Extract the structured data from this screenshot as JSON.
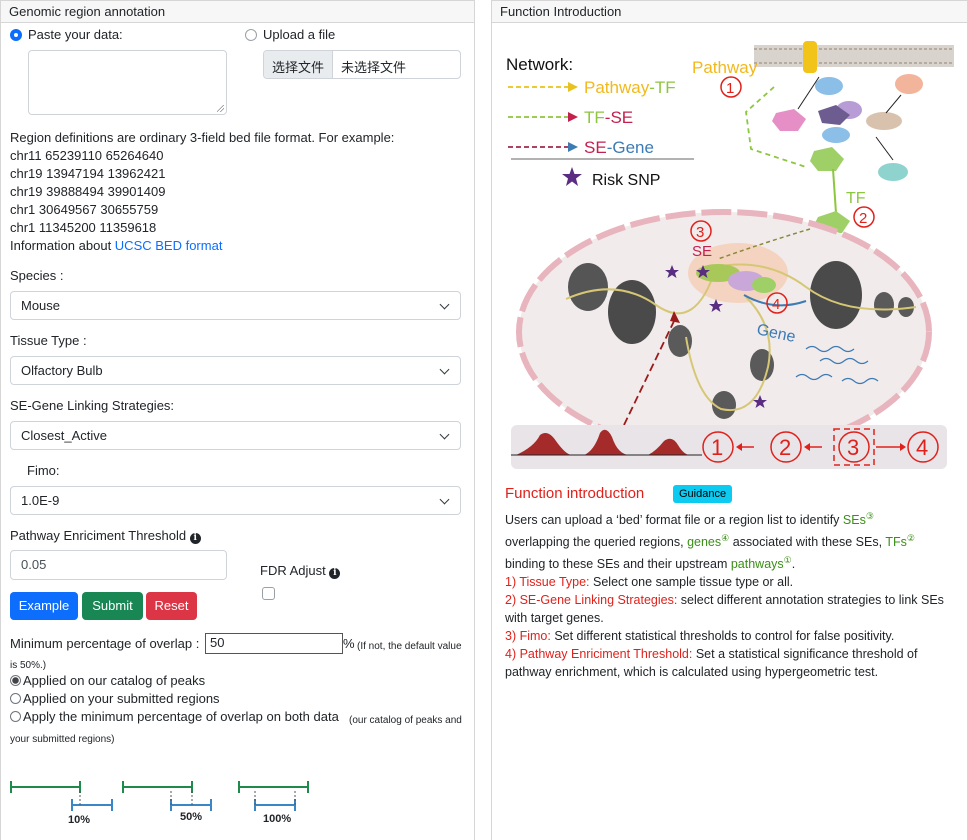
{
  "left": {
    "header": "Genomic region annotation",
    "paste_label": "Paste your data:",
    "upload_label": "Upload a file",
    "file_button": "选择文件",
    "file_status": "未选择文件",
    "bed_intro": "Region definitions are ordinary 3-field bed file format. For example:",
    "bed_examples": [
      "chr11 65239110 65264640",
      "chr19 13947194 13962421",
      "chr19 39888494 39901409",
      "chr1 30649567 30655759",
      "chr1 11345200 11359618"
    ],
    "info_prefix": "Information about ",
    "info_link": "UCSC BED format",
    "species_label": "Species :",
    "species_value": "Mouse",
    "tissue_label": "Tissue Type :",
    "tissue_value": "Olfactory Bulb",
    "linking_label": "SE-Gene Linking Strategies:",
    "linking_value": "Closest_Active",
    "fimo_label": "Fimo:",
    "fimo_value": "1.0E-9",
    "pathway_label": "Pathway Enriciment Threshold",
    "pathway_value": "0.05",
    "fdr_label": "FDR Adjust",
    "buttons": {
      "example": "Example",
      "submit": "Submit",
      "reset": "Reset"
    },
    "overlap_label": "Minimum percentage of overlap :",
    "overlap_value": "50",
    "overlap_unit": "%",
    "overlap_note_a": "(If not, the default value",
    "overlap_note_b": "is 50%.)",
    "options": [
      "Applied on our catalog of peaks",
      "Applied on your submitted regions",
      "Apply the minimum percentage of overlap on both data"
    ],
    "option3_note_a": "(our catalog of peaks and",
    "option3_note_b": "your submitted regions)",
    "overlap_figs": [
      "10%",
      "50%",
      "100%"
    ]
  },
  "right": {
    "header": "Function Introduction",
    "diagram": {
      "network": "Network:",
      "legend": [
        {
          "a": "Pathway",
          "b": "-TF",
          "color_a": "#f2b81c",
          "color_b": "#8dc63f"
        },
        {
          "a": "TF",
          "b": "-SE",
          "color_a": "#8dc63f",
          "color_b": "#c4204e"
        },
        {
          "a": "SE",
          "b": "-Gene",
          "color_a": "#c4204e",
          "color_b": "#3d7bb5"
        }
      ],
      "risk_snp": "Risk SNP",
      "pathway": "Pathway",
      "tf": "TF",
      "se": "SE",
      "gene": "Gene",
      "nums": [
        "1",
        "2",
        "3",
        "4"
      ]
    },
    "title": "Function introduction",
    "guidance": "Guidance",
    "p1_a": "Users can upload a ‘bed’ format file or a region list to identify ",
    "p1_ses": "SEs",
    "p1_b": "overlapping the queried regions, ",
    "p1_genes": "genes",
    "p1_c": " associated with these SEs, ",
    "p1_tfs": "TFs",
    "p1_d": "binding to these SEs and their upstream ",
    "p1_paths": "pathways",
    "sup3": "③",
    "sup4": "④",
    "sup2": "②",
    "sup1": "①",
    "items": [
      {
        "k": "1) Tissue Type:",
        "v": " Select one sample tissue type or all."
      },
      {
        "k": "2) SE-Gene Linking Strategies:",
        "v": " select different annotation strategies to link SEs",
        "v2": "with target genes."
      },
      {
        "k": "3) Fimo:",
        "v": " Set different statistical thresholds to control for false positivity."
      },
      {
        "k": "4) Pathway Enriciment Threshold:",
        "v": " Set a statistical significance threshold of",
        "v2": "pathway enrichment, which is calculated using hypergeometric test."
      }
    ]
  }
}
